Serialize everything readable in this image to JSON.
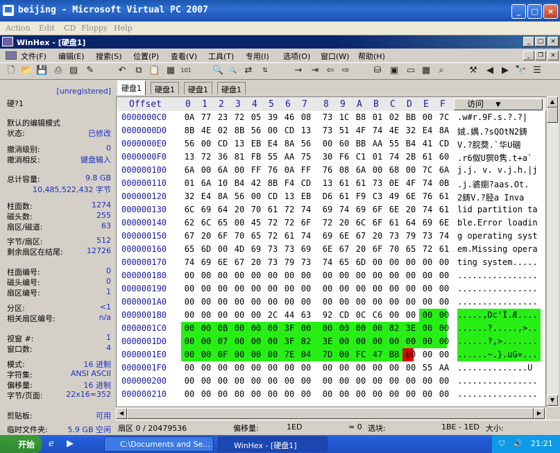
{
  "vpc": {
    "title": "beijing - Microsoft Virtual PC 2007",
    "menu": [
      "Action",
      "Edit",
      "CD",
      "Floppy",
      "Help"
    ]
  },
  "winhex": {
    "title": "WinHex - [硬盘1]"
  },
  "menu": [
    "文件(F)",
    "编辑(E)",
    "搜索(S)",
    "位置(P)",
    "查看(V)",
    "工具(T)",
    "专用(I)",
    "选项(O)",
    "窗口(W)",
    "帮助(H)"
  ],
  "toolbar": {
    "hex1": "HEX",
    "hex2": "HEX"
  },
  "tabs": [
    "硬盘1",
    "硬盘1",
    "硬盘1",
    "硬盘1"
  ],
  "info": {
    "unregistered": "[unregistered]",
    "disk": "硬?1",
    "l1": "默认的编辑模式",
    "l2": "状态:",
    "v2": "已修改",
    "l3": "撤消级别:",
    "v3": "0",
    "l4": "撤消相反:",
    "v4": "键盘输入",
    "l5": "总计容量:",
    "v5": "9.8 GB",
    "v5b": "10,485,522,432 字节",
    "l6": "柱面数:",
    "v6": "1274",
    "l7": "磁头数:",
    "v7": "255",
    "l8": "扇区/磁道:",
    "v8": "63",
    "l9": "字节/扇区:",
    "v9": "512",
    "l10": "剩余扇区在结尾:",
    "v10": "12726",
    "l11": "柱面编号:",
    "v11": "0",
    "l12": "磁头编号:",
    "v12": "0",
    "l13": "扇区编号:",
    "v13": "1",
    "l14": "分区:",
    "v14": "<1",
    "l15": "相关扇区编号:",
    "v15": "n/a",
    "l16": "视窗 #:",
    "v16": "1",
    "l17": "窗口数:",
    "v17": "4",
    "l18": "模式:",
    "v18": "16 进制",
    "l19": "字符集:",
    "v19": "ANSI ASCII",
    "l20": "偏移量:",
    "v20": "16 进制",
    "l21": "字节/页面:",
    "v21": "22x16=352",
    "l22": "剪贴板:",
    "v22": "可用",
    "l23": "临时文件夹:",
    "v23": "5.9 GB 空闲"
  },
  "hex": {
    "offset_label": "Offset",
    "cols": [
      "0",
      "1",
      "2",
      "3",
      "4",
      "5",
      "6",
      "7",
      "8",
      "9",
      "A",
      "B",
      "C",
      "D",
      "E",
      "F"
    ],
    "visit": "访问",
    "rows": [
      {
        "off": "0000000C0",
        "b": "0A 77 23 72 05 39 46 08 73 1C B8 01 02 BB 00 7C",
        "a": ".w#r.9F.s.?.?|"
      },
      {
        "off": "0000000D0",
        "b": "8B 4E 02 8B 56 00 CD 13 73 51 4F 74 4E 32 E4 8A",
        "a": "娀.媀.?sQOtN2鋳"
      },
      {
        "off": "0000000E0",
        "b": "56 00 CD 13 EB E4 8A 56 00 60 BB AA 55 B4 41 CD",
        "a": "V.?脘奦.`华U碅"
      },
      {
        "off": "0000000F0",
        "b": "13 72 36 81 FB 55 AA 75 30 F6 C1 01 74 2B 61 60",
        "a": ".r6伮U猽0隽.t+a`"
      },
      {
        "off": "000000100",
        "b": "6A 00 6A 00 FF 76 0A FF 76 08 6A 00 68 00 7C 6A",
        "a": "j.j. v. v.j.h.|j"
      },
      {
        "off": "000000110",
        "b": "01 6A 10 B4 42 8B F4 CD 13 61 61 73 0E 4F 74 0B",
        "a": ".j.碆嬼?aas.Ot."
      },
      {
        "off": "000000120",
        "b": "32 E4 8A 56 00 CD 13 EB D6 61 F9 C3 49 6E 76 61",
        "a": "2鋳V.?胫a Inva"
      },
      {
        "off": "000000130",
        "b": "6C 69 64 20 70 61 72 74 69 74 69 6F 6E 20 74 61",
        "a": "lid partition ta"
      },
      {
        "off": "000000140",
        "b": "62 6C 65 00 45 72 72 6F 72 20 6C 6F 61 64 69 6E",
        "a": "ble.Error loadin"
      },
      {
        "off": "000000150",
        "b": "67 20 6F 70 65 72 61 74 69 6E 67 20 73 79 73 74",
        "a": "g operating syst"
      },
      {
        "off": "000000160",
        "b": "65 6D 00 4D 69 73 73 69 6E 67 20 6F 70 65 72 61",
        "a": "em.Missing opera"
      },
      {
        "off": "000000170",
        "b": "74 69 6E 67 20 73 79 73 74 65 6D 00 00 00 00 00",
        "a": "ting system....."
      },
      {
        "off": "000000180",
        "b": "00 00 00 00 00 00 00 00 00 00 00 00 00 00 00 00",
        "a": "................"
      },
      {
        "off": "000000190",
        "b": "00 00 00 00 00 00 00 00 00 00 00 00 00 00 00 00",
        "a": "................"
      },
      {
        "off": "0000001A0",
        "b": "00 00 00 00 00 00 00 00 00 00 00 00 00 00 00 00",
        "a": "................"
      },
      {
        "off": "0000001B0",
        "b": "00 00 00 00 00 2C 44 63 92 CD 0C C6 00 00 00 00",
        "a": ".....,Dc'Í.Æ...."
      },
      {
        "off": "0000001C0",
        "b": "00 00 0B 00 00 00 3F 00 00 00 00 00 82 3E 00 00",
        "a": "......?.....,>.."
      },
      {
        "off": "0000001D0",
        "b": "00 00 07 00 00 00 3F 82 3E 00 00 00 00 00 00 00",
        "a": "......?,>......."
      },
      {
        "off": "0000001E0",
        "b": "00 00 0F 00 00 00 7E 04 7D 00 FC 47 BB 00 00 00",
        "a": "......~.}.uG»..."
      },
      {
        "off": "0000001F0",
        "b": "00 00 00 00 00 00 00 00 00 00 00 00 00 00 55 AA",
        "a": "..............U"
      },
      {
        "off": "000000200",
        "b": "00 00 00 00 00 00 00 00 00 00 00 00 00 00 00 00",
        "a": "................"
      },
      {
        "off": "000000210",
        "b": "00 00 00 00 00 00 00 00 00 00 00 00 00 00 00 00",
        "a": "................"
      }
    ]
  },
  "status": {
    "sector": "扇区 0 / 20479536",
    "offset_label": "偏移量:",
    "offset_val": "1ED",
    "eq": "= 0",
    "select_label": "选块:",
    "select_val": "1BE - 1ED",
    "size_label": "大小:"
  },
  "taskbar": {
    "start": "开始",
    "task1": "C:\\Documents and Se...",
    "task2": "WinHex - [硬盘1]",
    "clock": "21:21"
  },
  "colors": {
    "highlight": "#27ef16",
    "cursor": "#e00000",
    "title": "#0a246a"
  }
}
